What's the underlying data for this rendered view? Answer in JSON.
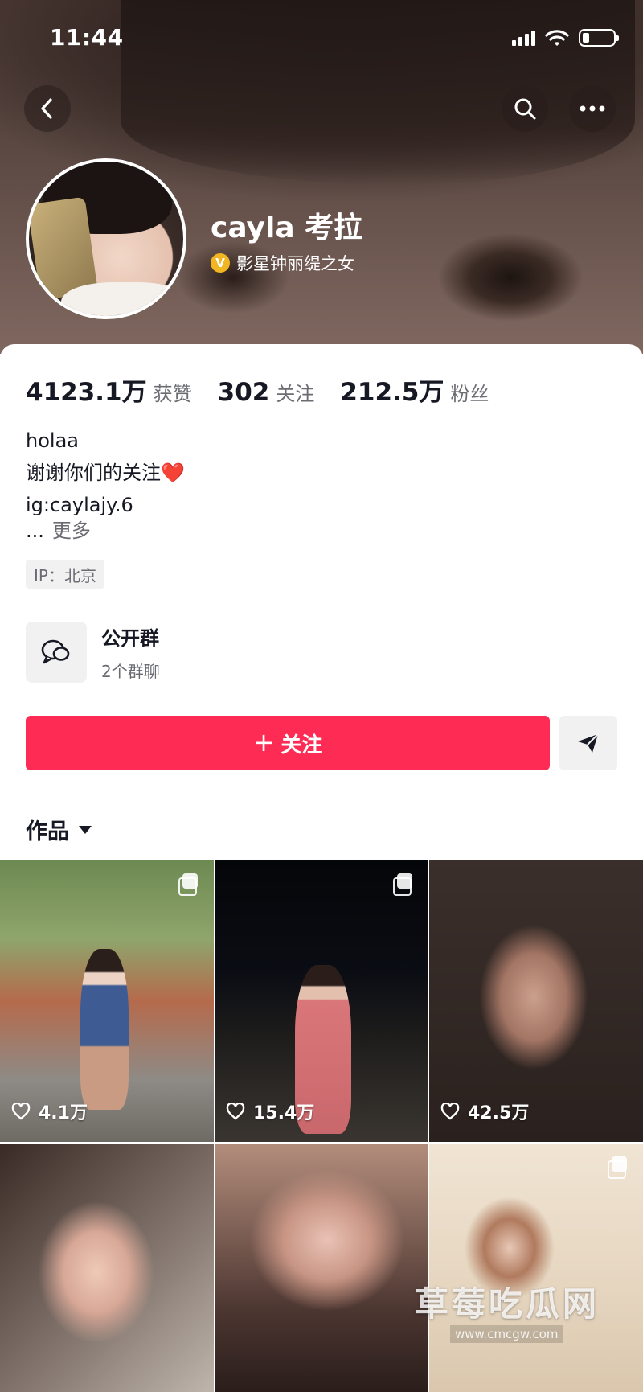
{
  "status_bar": {
    "time": "11:44",
    "battery_level": 0.22
  },
  "header": {
    "back_icon": "chevron-left-icon",
    "search_icon": "search-icon",
    "more_icon": "more-horizontal-icon"
  },
  "profile": {
    "name": "cayla 考拉",
    "verify_badge": "V",
    "verify_text": "影星钟丽缇之女"
  },
  "stats": [
    {
      "value": "4123.1万",
      "label": "获赞"
    },
    {
      "value": "302",
      "label": "关注"
    },
    {
      "value": "212.5万",
      "label": "粉丝"
    }
  ],
  "bio": {
    "line1": "holaa",
    "line2": "谢谢你们的关注",
    "line2_emoji": "❤️",
    "line3": "ig:caylajy.6",
    "ellipsis": "...",
    "more": "更多"
  },
  "ip": "IP：北京",
  "group": {
    "title": "公开群",
    "subtitle": "2个群聊"
  },
  "actions": {
    "follow_plus": "+",
    "follow_label": "关注"
  },
  "works_tab": {
    "label": "作品"
  },
  "videos": [
    {
      "likes": "4.1万",
      "multi": true
    },
    {
      "likes": "15.4万",
      "multi": true
    },
    {
      "likes": "42.5万",
      "multi": false
    },
    {
      "likes": "",
      "multi": false
    },
    {
      "likes": "",
      "multi": false
    },
    {
      "likes": "",
      "multi": true
    }
  ],
  "watermark": {
    "title": "草莓吃瓜网",
    "url": "www.cmcgw.com"
  },
  "colors": {
    "accent": "#fe2c55",
    "badge": "#f2b622",
    "text": "#161823",
    "secondary": "#6b6c72"
  }
}
